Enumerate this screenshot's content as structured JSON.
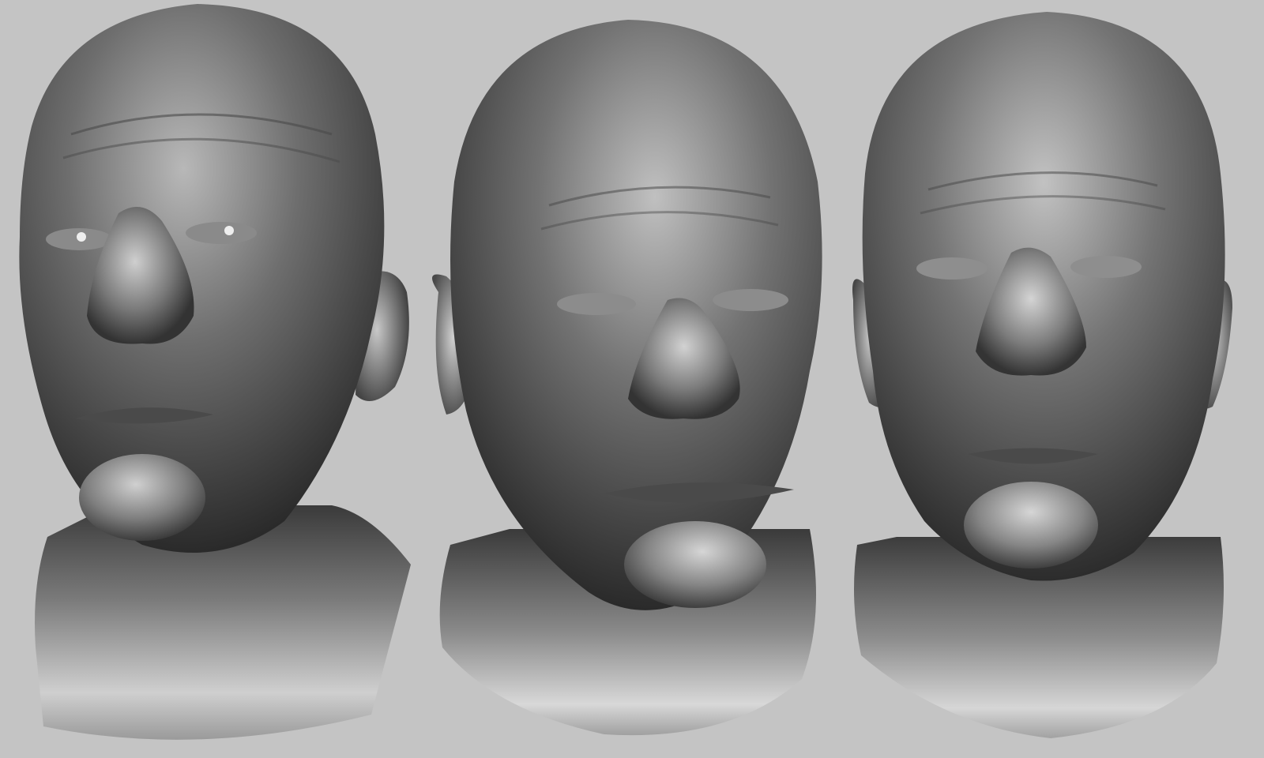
{
  "scene": {
    "background_color": "#c4c4c4",
    "material_color": "#6b6b6b",
    "highlight_color": "#d8d8d8",
    "shadow_color": "#2e2e2e"
  },
  "heads": [
    {
      "view": "three-quarter-up-left"
    },
    {
      "view": "three-quarter-down-right"
    },
    {
      "view": "front"
    }
  ]
}
